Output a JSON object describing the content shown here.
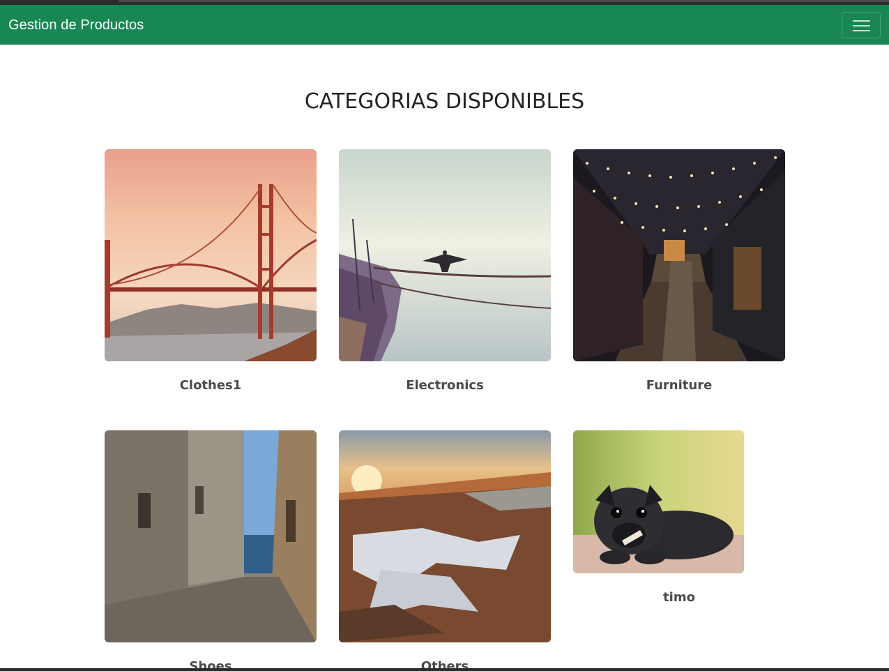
{
  "app": {
    "brand": "Gestion de Productos"
  },
  "nav": {
    "toggler_icon": "hamburger-menu-icon"
  },
  "main": {
    "title": "CATEGORIAS DISPONIBLES",
    "categories": [
      {
        "name": "Clothes1",
        "image": "golden-gate-bridge-photo"
      },
      {
        "name": "Electronics",
        "image": "bird-on-boat-rope-photo"
      },
      {
        "name": "Furniture",
        "image": "string-lights-alley-photo"
      },
      {
        "name": "Shoes",
        "image": "narrow-street-sea-view-photo"
      },
      {
        "name": "Others",
        "image": "sunset-frozen-field-photo"
      },
      {
        "name": "timo",
        "image": "black-pug-puppy-photo"
      }
    ]
  },
  "colors": {
    "navbar": "#198754",
    "text": "#212529",
    "label": "#4a4a4a"
  }
}
